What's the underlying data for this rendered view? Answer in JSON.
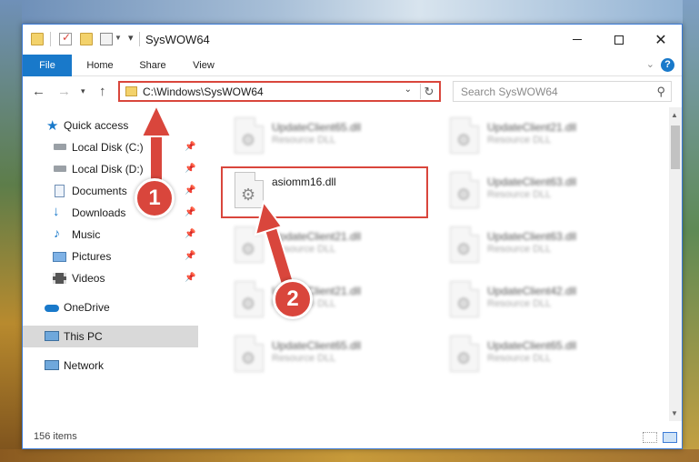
{
  "window": {
    "title": "SysWOW64"
  },
  "ribbon": {
    "tabs": [
      {
        "label": "File"
      },
      {
        "label": "Home"
      },
      {
        "label": "Share"
      },
      {
        "label": "View"
      }
    ],
    "help_label": "?"
  },
  "address": {
    "path": "C:\\Windows\\SysWOW64"
  },
  "search": {
    "placeholder": "Search SysWOW64"
  },
  "sidebar": {
    "items": [
      {
        "label": "Quick access",
        "icon": "star-icon"
      },
      {
        "label": "Local Disk (C:)",
        "icon": "drive-icon",
        "pinned": true
      },
      {
        "label": "Local Disk (D:)",
        "icon": "drive-icon",
        "pinned": true
      },
      {
        "label": "Documents",
        "icon": "documents-icon",
        "pinned": true
      },
      {
        "label": "Downloads",
        "icon": "download-icon",
        "pinned": true
      },
      {
        "label": "Music",
        "icon": "music-icon",
        "pinned": true
      },
      {
        "label": "Pictures",
        "icon": "pictures-icon",
        "pinned": true
      },
      {
        "label": "Videos",
        "icon": "videos-icon",
        "pinned": true
      },
      {
        "label": "OneDrive",
        "icon": "cloud-icon"
      },
      {
        "label": "This PC",
        "icon": "computer-icon",
        "selected": true
      },
      {
        "label": "Network",
        "icon": "network-icon"
      }
    ]
  },
  "files": [
    {
      "name": "UpdateClient65.dll",
      "desc": "Resource DLL",
      "blurred": true
    },
    {
      "name": "UpdateClient21.dll",
      "desc": "Resource DLL",
      "blurred": true
    },
    {
      "name": "asiomm16.dll",
      "desc": "",
      "blurred": false
    },
    {
      "name": "UpdateClient63.dll",
      "desc": "Resource DLL",
      "blurred": true
    },
    {
      "name": "UpdateClient21.dll",
      "desc": "Resource DLL",
      "blurred": true
    },
    {
      "name": "UpdateClient63.dll",
      "desc": "Resource DLL",
      "blurred": true
    },
    {
      "name": "UpdateClient21.dll",
      "desc": "Resource DLL",
      "blurred": true
    },
    {
      "name": "UpdateClient42.dll",
      "desc": "Resource DLL",
      "blurred": true
    },
    {
      "name": "UpdateClient65.dll",
      "desc": "Resource DLL",
      "blurred": true
    },
    {
      "name": "UpdateClient65.dll",
      "desc": "Resource DLL",
      "blurred": true
    }
  ],
  "status": {
    "count": "156 items"
  },
  "annotations": {
    "step1": "1",
    "step2": "2",
    "color": "#d9463c"
  }
}
